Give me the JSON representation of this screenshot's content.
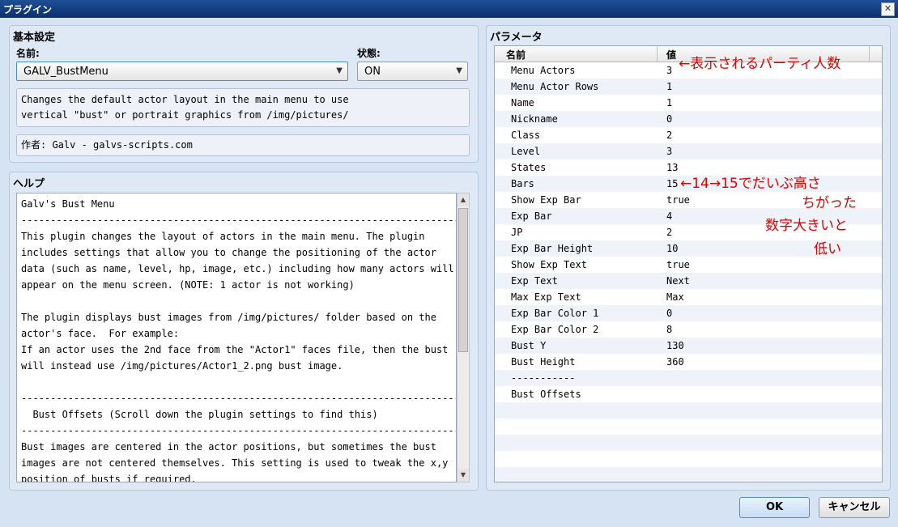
{
  "window": {
    "title": "プラグイン",
    "close_glyph": "✕"
  },
  "basic": {
    "title": "基本設定",
    "name_label": "名前:",
    "name_value": "GALV_BustMenu",
    "state_label": "状態:",
    "state_value": "ON",
    "description": "Changes the default actor layout in the main menu to use\nvertical \"bust\" or portrait graphics from /img/pictures/",
    "author": "作者: Galv - galvs-scripts.com"
  },
  "help": {
    "title": "ヘルプ",
    "text": "Galv's Bust Menu\n---------------------------------------------------------------------------\nThis plugin changes the layout of actors in the main menu. The plugin\nincludes settings that allow you to change the positioning of the actor\ndata (such as name, level, hp, image, etc.) including how many actors will\nappear on the menu screen. (NOTE: 1 actor is not working)\n\nThe plugin displays bust images from /img/pictures/ folder based on the\nactor's face.  For example:\nIf an actor uses the 2nd face from the \"Actor1\" faces file, then the bust\nwill instead use /img/pictures/Actor1_2.png bust image.\n\n---------------------------------------------------------------------------\n  Bust Offsets (Scroll down the plugin settings to find this)\n---------------------------------------------------------------------------\nBust images are centered in the actor positions, but sometimes the bust\nimages are not centered themselves. This setting is used to tweak the x,y\nposition of busts if required."
  },
  "params": {
    "title": "パラメータ",
    "col_name": "名前",
    "col_value": "値",
    "rows": [
      {
        "name": "Menu Actors",
        "value": "3"
      },
      {
        "name": "Menu Actor Rows",
        "value": "1"
      },
      {
        "name": "Name",
        "value": "1"
      },
      {
        "name": "Nickname",
        "value": "0"
      },
      {
        "name": "Class",
        "value": "2"
      },
      {
        "name": "Level",
        "value": "3"
      },
      {
        "name": "States",
        "value": "13"
      },
      {
        "name": "Bars",
        "value": "15"
      },
      {
        "name": "Show Exp Bar",
        "value": "true"
      },
      {
        "name": "Exp Bar",
        "value": "4"
      },
      {
        "name": "JP",
        "value": "2"
      },
      {
        "name": "Exp Bar Height",
        "value": "10"
      },
      {
        "name": "Show Exp Text",
        "value": "true"
      },
      {
        "name": "Exp Text",
        "value": "Next"
      },
      {
        "name": "Max Exp Text",
        "value": "Max"
      },
      {
        "name": "Exp Bar Color 1",
        "value": "0"
      },
      {
        "name": "Exp Bar Color 2",
        "value": "8"
      },
      {
        "name": "Bust Y",
        "value": "130"
      },
      {
        "name": "Bust Height",
        "value": "360"
      },
      {
        "name": "-----------",
        "value": ""
      },
      {
        "name": "Bust Offsets",
        "value": ""
      },
      {
        "name": "",
        "value": ""
      },
      {
        "name": "",
        "value": ""
      },
      {
        "name": "",
        "value": ""
      },
      {
        "name": "",
        "value": ""
      },
      {
        "name": "",
        "value": ""
      }
    ]
  },
  "annotations": {
    "menu_actors_note": "←表示されるパーティ人数",
    "bars_note": "←14→15でだいぶ高さ",
    "bars_note2": "ちがった",
    "bars_note3": "数字大きいと",
    "bars_note4": "低い",
    "color": "#e00000"
  },
  "buttons": {
    "ok": "OK",
    "cancel": "キャンセル"
  }
}
